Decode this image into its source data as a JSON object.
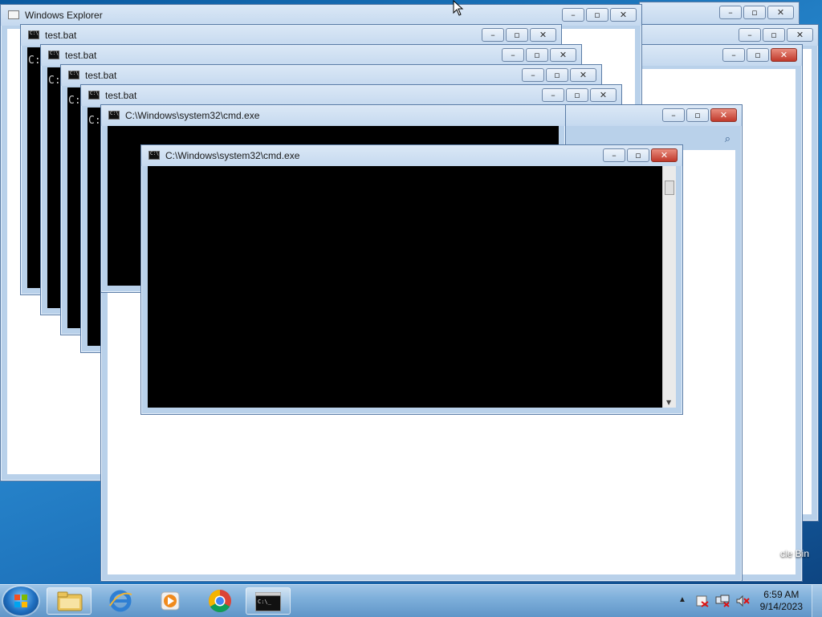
{
  "windows": {
    "explorer": {
      "title": "Windows Explorer"
    },
    "bat1": {
      "title": "test.bat",
      "prompt": "C:"
    },
    "bat2": {
      "title": "test.bat",
      "prompt": "C:"
    },
    "bat3": {
      "title": "test.bat",
      "prompt": "C:"
    },
    "bat4": {
      "title": "test.bat",
      "prompt": "C:"
    },
    "cmd1": {
      "title": "C:\\Windows\\system32\\cmd.exe"
    },
    "cmd2": {
      "title": "C:\\Windows\\system32\\cmd.exe"
    }
  },
  "buttons": {
    "minimize": "–",
    "maximize": "▫",
    "close": "✕"
  },
  "desktop": {
    "recycle_bin_label": "cle Bin"
  },
  "taskbar": {
    "items": [
      "start-button",
      "file-explorer",
      "internet-explorer",
      "media-player",
      "chrome",
      "cmd"
    ],
    "clock": {
      "time": "6:59 AM",
      "date": "9/14/2023"
    }
  },
  "colors": {
    "titlebar": "#c5d9ef",
    "console_bg": "#000000",
    "close_red": "#c0392b",
    "taskbar": "#7fb0db"
  }
}
